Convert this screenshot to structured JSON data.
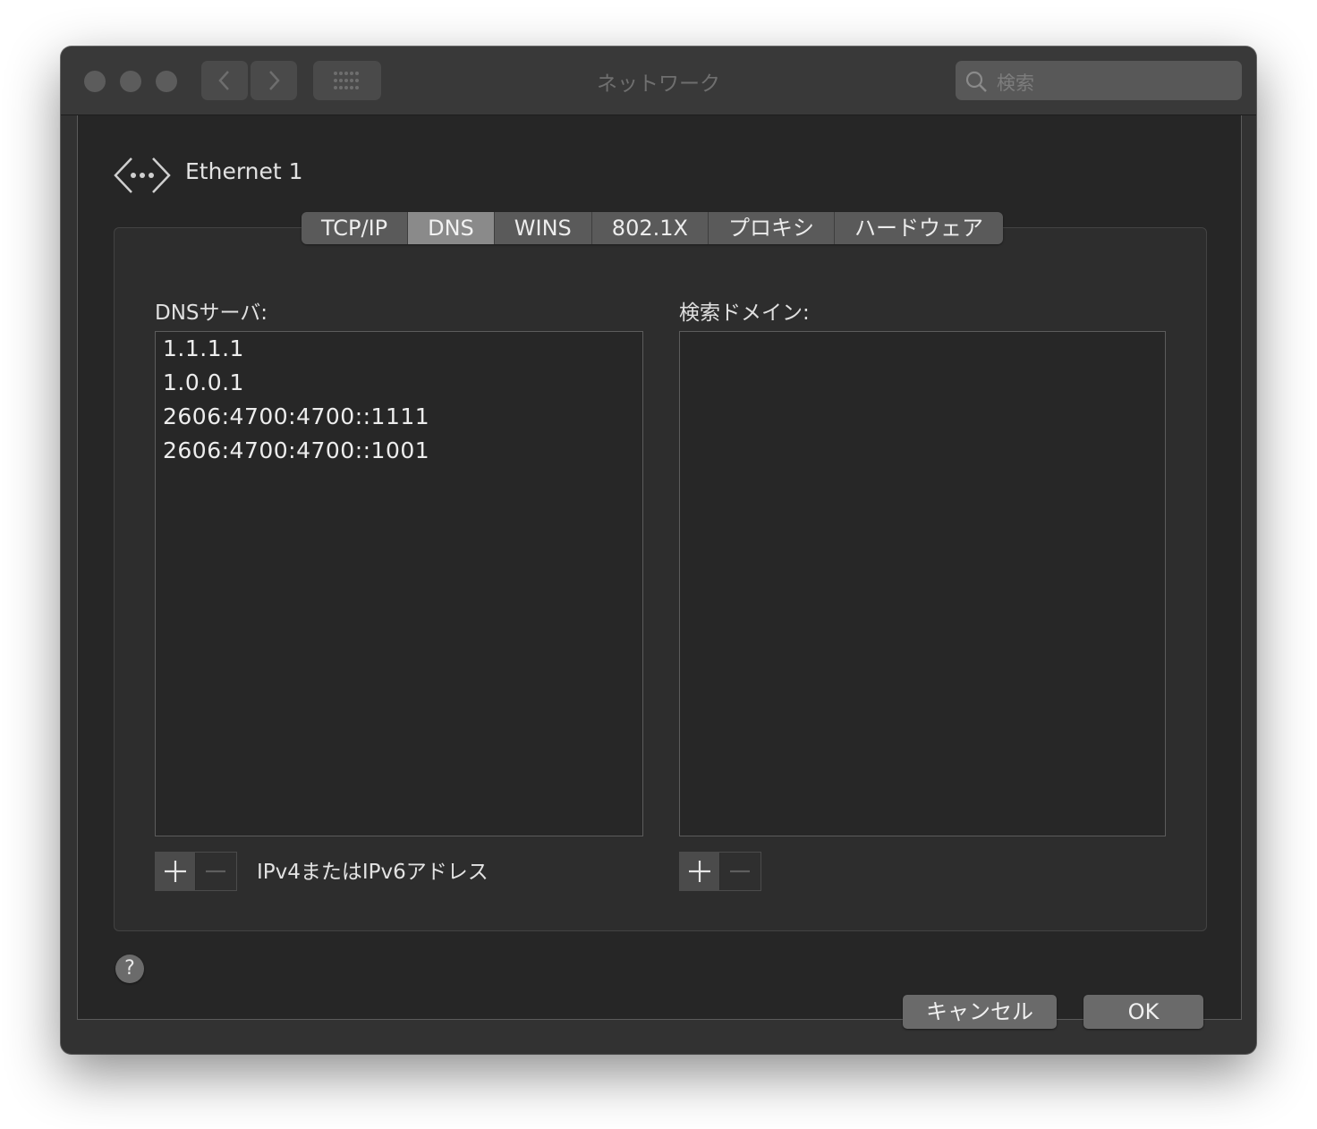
{
  "window": {
    "title": "ネットワーク",
    "search_placeholder": "検索"
  },
  "interface": {
    "name": "Ethernet 1",
    "icon": "ethernet-arrows-icon"
  },
  "tabs": [
    {
      "label": "TCP/IP",
      "active": false
    },
    {
      "label": "DNS",
      "active": true
    },
    {
      "label": "WINS",
      "active": false
    },
    {
      "label": "802.1X",
      "active": false
    },
    {
      "label": "プロキシ",
      "active": false
    },
    {
      "label": "ハードウェア",
      "active": false
    }
  ],
  "dns": {
    "label": "DNSサーバ:",
    "servers": [
      "1.1.1.1",
      "1.0.0.1",
      "2606:4700:4700::1111",
      "2606:4700:4700::1001"
    ],
    "hint": "IPv4またはIPv6アドレス"
  },
  "search_domains": {
    "label": "検索ドメイン:",
    "domains": []
  },
  "footer": {
    "help": "?",
    "cancel": "キャンセル",
    "ok": "OK"
  }
}
